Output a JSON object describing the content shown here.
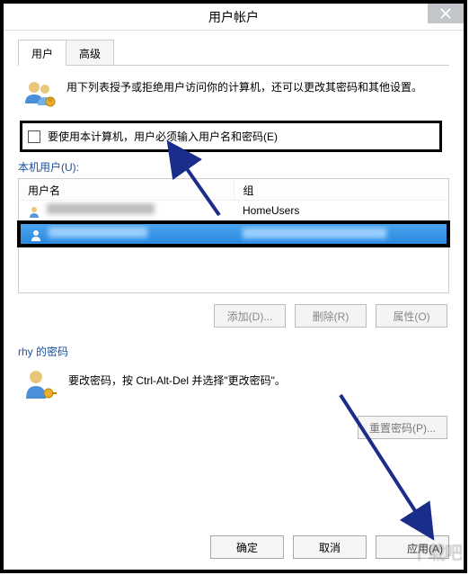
{
  "titlebar": {
    "title": "用户帐户"
  },
  "tabs": {
    "active": "用户",
    "inactive": "高级"
  },
  "main": {
    "description": "用下列表授予或拒绝用户访问你的计算机，还可以更改其密码和其他设置。"
  },
  "checkbox": {
    "label": "要使用本计算机，用户必须输入用户名和密码(E)"
  },
  "userlist": {
    "heading": "本机用户(U):",
    "columns": {
      "name": "用户名",
      "group": "组"
    },
    "rows": [
      {
        "name": "",
        "group": "HomeUsers",
        "selected": false
      },
      {
        "name": "",
        "group": "",
        "selected": true
      }
    ]
  },
  "buttons": {
    "add": "添加(D)...",
    "remove": "删除(R)",
    "properties": "属性(O)"
  },
  "password": {
    "heading": "rhy 的密码",
    "description": "要改密码，按 Ctrl-Alt-Del 并选择\"更改密码\"。",
    "reset_button": "重置密码(P)..."
  },
  "dialog_buttons": {
    "ok": "确定",
    "cancel": "取消",
    "apply": "应用(A)"
  }
}
